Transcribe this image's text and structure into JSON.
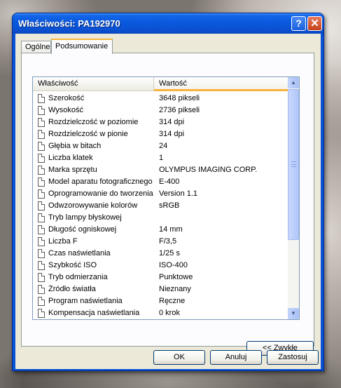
{
  "window": {
    "title": "Właściwości: PA192970",
    "help_glyph": "?",
    "close_glyph": "✕"
  },
  "tabs": [
    {
      "label": "Ogólne",
      "selected": false
    },
    {
      "label": "Podsumowanie",
      "selected": true
    }
  ],
  "list": {
    "columns": {
      "property": "Właściwość",
      "value": "Wartość"
    },
    "rows": [
      {
        "property": "Szerokość",
        "value": "3648 pikseli"
      },
      {
        "property": "Wysokość",
        "value": "2736 pikseli"
      },
      {
        "property": "Rozdzielczość w poziomie",
        "value": "314 dpi"
      },
      {
        "property": "Rozdzielczość w pionie",
        "value": "314 dpi"
      },
      {
        "property": "Głębia w bitach",
        "value": "24"
      },
      {
        "property": "Liczba klatek",
        "value": "1"
      },
      {
        "property": "Marka sprzętu",
        "value": "OLYMPUS IMAGING CORP."
      },
      {
        "property": "Model aparatu fotograficznego",
        "value": "E-400"
      },
      {
        "property": "Oprogramowanie do tworzenia",
        "value": "Version 1.1"
      },
      {
        "property": "Odwzorowywanie kolorów",
        "value": "sRGB"
      },
      {
        "property": "Tryb lampy błyskowej",
        "value": ""
      },
      {
        "property": "Długość ogniskowej",
        "value": "14 mm"
      },
      {
        "property": "Liczba F",
        "value": "F/3,5"
      },
      {
        "property": "Czas naświetlania",
        "value": "1/25 s"
      },
      {
        "property": "Szybkość ISO",
        "value": "ISO-400"
      },
      {
        "property": "Tryb odmierzania",
        "value": "Punktowe"
      },
      {
        "property": "Źródło światła",
        "value": "Nieznany"
      },
      {
        "property": "Program naświetlania",
        "value": "Ręczne"
      },
      {
        "property": "Kompensacja naświetlania",
        "value": "0 krok"
      },
      {
        "property": "",
        "value": ""
      }
    ],
    "icon": "document-icon"
  },
  "buttons": {
    "simple": "<< Zwykłe",
    "ok": "OK",
    "cancel": "Anuluj",
    "apply": "Zastosuj"
  },
  "colors": {
    "titlebar": "#0a58dc",
    "header_accent": "#f9b13d",
    "dialog_face": "#ece9d8"
  }
}
